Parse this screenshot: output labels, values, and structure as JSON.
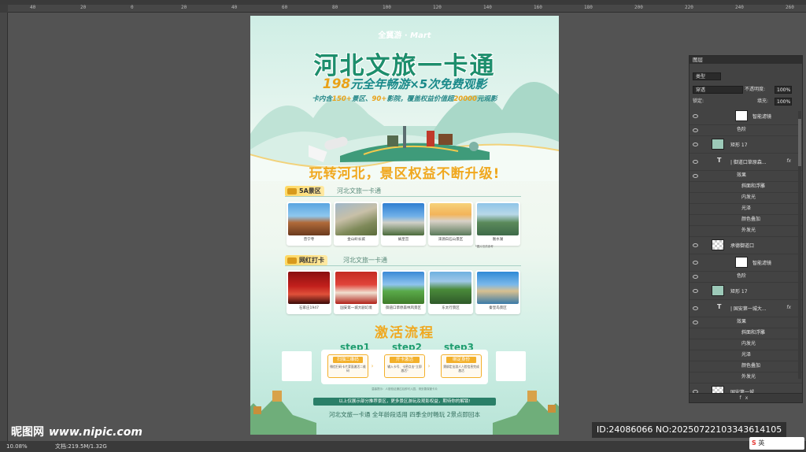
{
  "poster": {
    "brand_left": "全冀游",
    "brand_right": "Mart",
    "title": "河北文旅一卡通",
    "subtitle_num": "198",
    "subtitle_rest": "元全年畅游×5次免费观影",
    "desc_a": "卡内含",
    "desc_b": "150+",
    "desc_c": "景区、",
    "desc_d": "90+",
    "desc_e": "影院，覆盖权益价值超",
    "desc_f": "20000",
    "desc_g": "元观影",
    "slogan": "玩转河北，景区权益不断升级!",
    "section1": {
      "badge": "5A景区",
      "sub": "河北文旅一卡通"
    },
    "section2": {
      "badge": "网红打卡",
      "sub": "河北文旅一卡通"
    },
    "row1": [
      "普宁寺",
      "金山岭长城",
      "娲皇宫",
      "涞源白石山景区",
      "衡水湖"
    ],
    "row2": [
      "石家庄1947",
      "国安第一城大剧幻境",
      "御道口草原森林风景区",
      "东太行景区",
      "秦皇岛景区"
    ],
    "row1_note": "*图片仅供参考",
    "flow_title": "激活流程",
    "steps": [
      {
        "label": "step1",
        "head": "扫描二维码",
        "text": "微信扫码卡片背面激活二维码"
      },
      {
        "label": "step2",
        "head": "开卡激活",
        "text": "输入卡号、卡密点击\"立即激活\""
      },
      {
        "label": "step3",
        "head": "绑定身份",
        "text": "需绑定出游人人脸信息完成激活"
      }
    ],
    "flow_note": "温馨提示：人脸验证通过后即可入园，请妥善保管卡片",
    "bottom_note": "以上仅展示部分推荐景区，更多景区游玩及观影权益，期待你的解锁!",
    "bottom_text": "河北文旅一卡通 全年龄段适用 四季全时畅玩 2景点即回本"
  },
  "status": {
    "zoom": "10.08%",
    "doc": "文档:219.5M/1.32G"
  },
  "ruler": [
    "40",
    "20",
    "0",
    "20",
    "40",
    "60",
    "80",
    "100",
    "120",
    "140",
    "160",
    "180",
    "200",
    "220",
    "240",
    "260"
  ],
  "panel": {
    "tab": "图层",
    "kind": "类型",
    "blend": "穿透",
    "opacity_label": "不透明度:",
    "opacity": "100%",
    "lock_label": "锁定:",
    "fill_label": "填充:",
    "fill": "100%",
    "layers": [
      {
        "name": "智能滤镜",
        "type": "sub-thumb"
      },
      {
        "name": "色阶",
        "type": "sub"
      },
      {
        "name": "矩形 17",
        "type": "teal"
      },
      {
        "name": "| 御道口草原森...",
        "type": "text",
        "fx": "fx"
      },
      {
        "name": "效果",
        "type": "sub"
      },
      {
        "name": "斜面和浮雕",
        "type": "sub2"
      },
      {
        "name": "内发光",
        "type": "sub2"
      },
      {
        "name": "光泽",
        "type": "sub2"
      },
      {
        "name": "颜色叠加",
        "type": "sub2"
      },
      {
        "name": "外发光",
        "type": "sub2"
      },
      {
        "name": "承德御道口",
        "type": "check"
      },
      {
        "name": "智能滤镜",
        "type": "sub-thumb"
      },
      {
        "name": "色阶",
        "type": "sub"
      },
      {
        "name": "矩形 17",
        "type": "teal"
      },
      {
        "name": "| 国安第一城大...",
        "type": "text",
        "fx": "fx"
      },
      {
        "name": "效果",
        "type": "sub"
      },
      {
        "name": "斜面和浮雕",
        "type": "sub2"
      },
      {
        "name": "内发光",
        "type": "sub2"
      },
      {
        "name": "光泽",
        "type": "sub2"
      },
      {
        "name": "颜色叠加",
        "type": "sub2"
      },
      {
        "name": "外发光",
        "type": "sub2"
      },
      {
        "name": "国安第一城",
        "type": "check"
      },
      {
        "name": "智能滤镜",
        "type": "sub-thumb"
      }
    ],
    "footer": "fx"
  },
  "watermark": {
    "logo": "昵图网",
    "site": "www.nipic.com"
  },
  "id_text": "ID:24086066 NO:20250722103343614105",
  "ime": {
    "logo": "S",
    "lang": "英"
  }
}
